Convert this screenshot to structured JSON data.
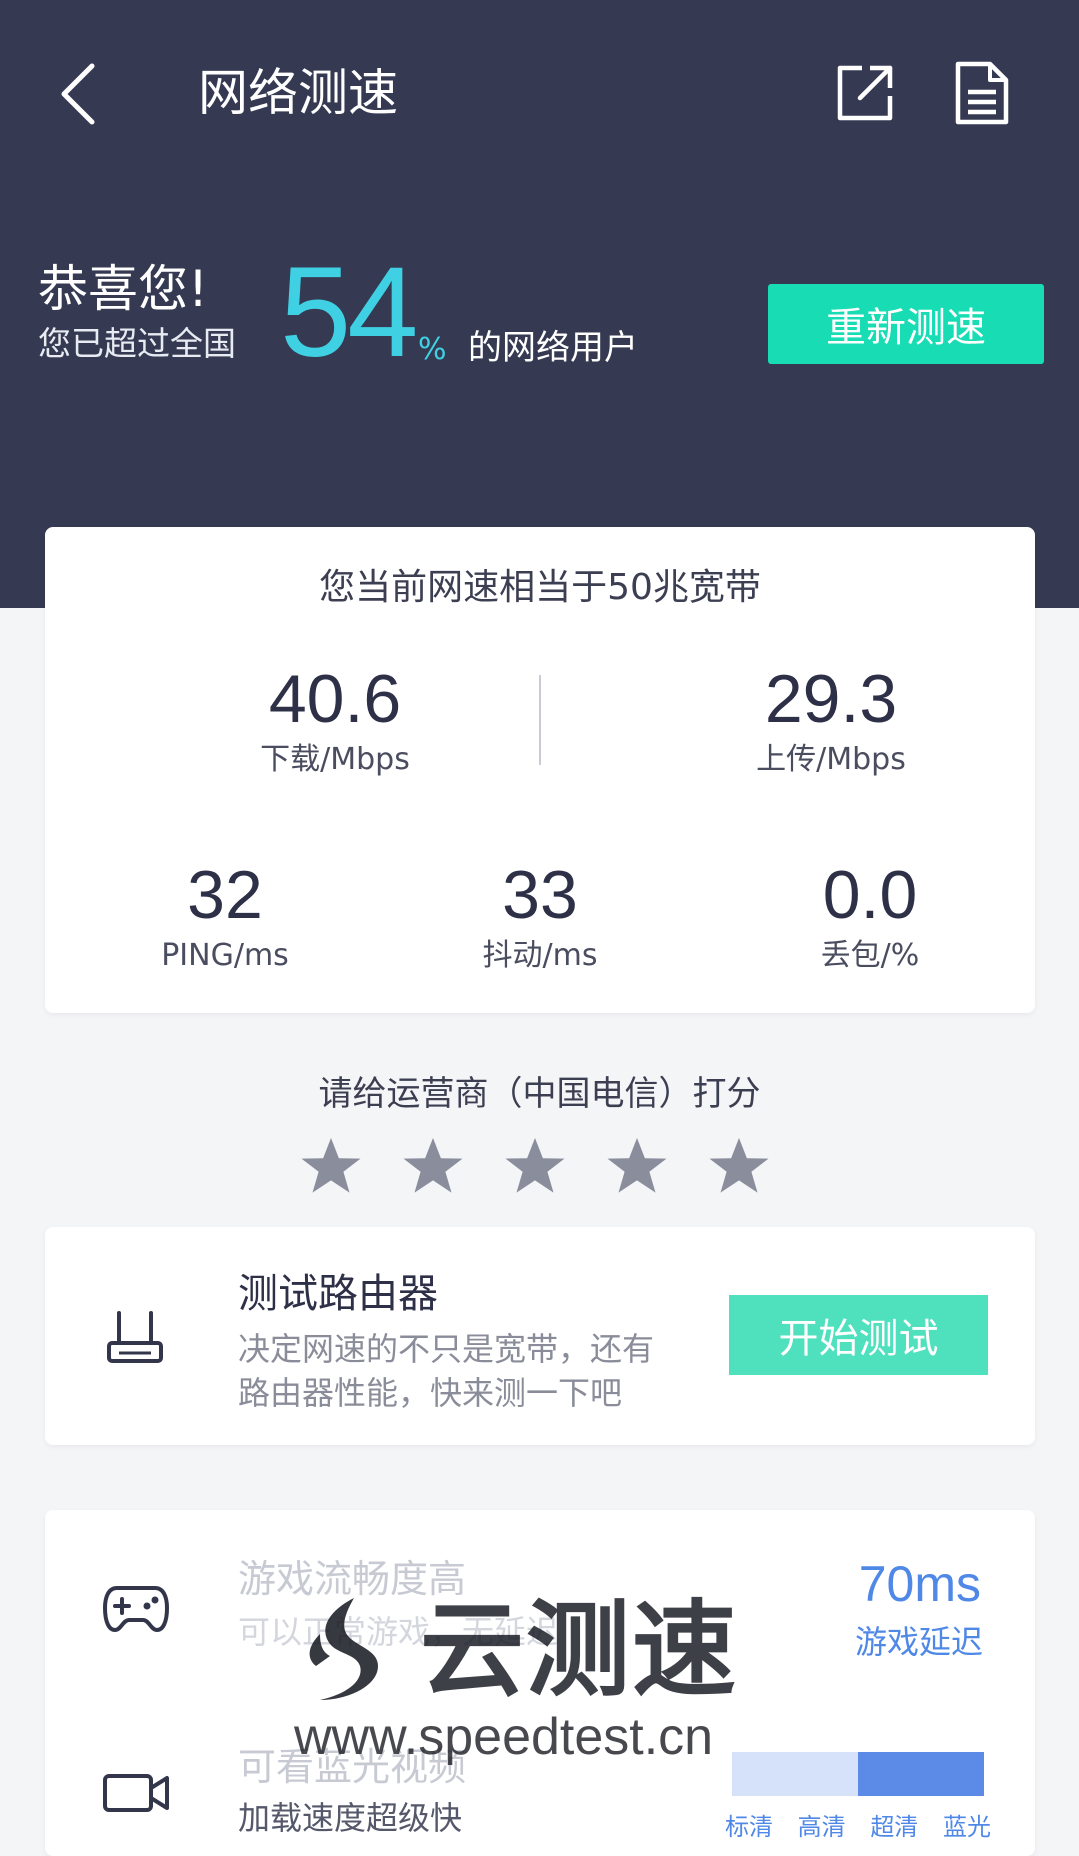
{
  "header": {
    "title": "网络测速",
    "back_icon": "chevron-left-icon",
    "share_icon": "share-external-icon",
    "report_icon": "document-icon"
  },
  "summary": {
    "title": "恭喜您!",
    "subtitle": "您已超过全国",
    "percent": "54",
    "percent_sign": "%",
    "suffix": "的网络用户",
    "retest_label": "重新测速"
  },
  "result": {
    "equivalent": "您当前网速相当于50兆宽带",
    "download": {
      "value": "40.6",
      "label": "下载/Mbps"
    },
    "upload": {
      "value": "29.3",
      "label": "上传/Mbps"
    },
    "ping": {
      "value": "32",
      "label": "PING/ms"
    },
    "jitter": {
      "value": "33",
      "label": "抖动/ms"
    },
    "loss": {
      "value": "0.0",
      "label": "丢包/%"
    }
  },
  "rating": {
    "title": "请给运营商（中国电信）打分",
    "stars": 5,
    "selected": 0
  },
  "router": {
    "title": "测试路由器",
    "desc_line1": "决定网速的不只是宽带，还有",
    "desc_line2": "路由器性能，快来测一下吧",
    "start_label": "开始测试"
  },
  "abilities": {
    "game_title": "游戏流畅度高",
    "game_desc": "可以正常游戏，无延迟",
    "latency_value": "70ms",
    "latency_label": "游戏延迟",
    "video_title": "可看蓝光视频",
    "video_desc": "加载速度超级快",
    "quality_levels": [
      "标清",
      "高清",
      "超清",
      "蓝光"
    ],
    "quality_level_reached": 3
  },
  "watermark": {
    "name": "云测速",
    "url": "www.speedtest.cn"
  },
  "colors": {
    "header_bg": "#353a52",
    "accent_cyan": "#3fd1e3",
    "retest_green": "#17dcb4",
    "start_green": "#4fe0bd",
    "star_gray": "#8a8d9c",
    "quality_blue": "#5b8be6",
    "quality_light": "#d6e2fa"
  }
}
